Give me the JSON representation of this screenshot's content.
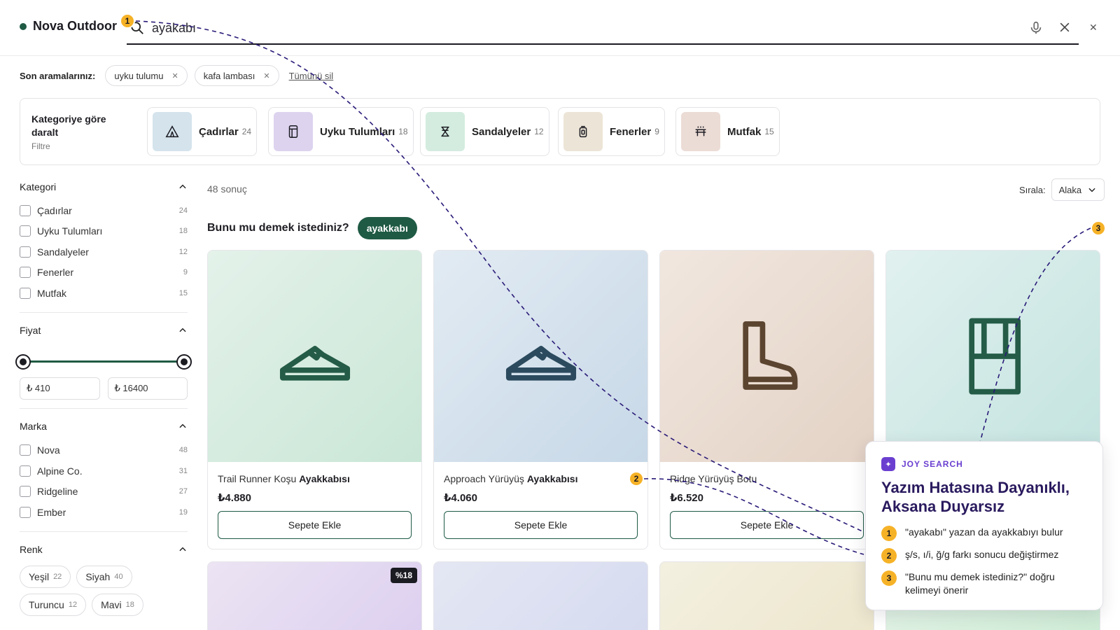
{
  "brand": {
    "name": "Nova Outdoor",
    "dot_color": "#1f5a44"
  },
  "search": {
    "value": "ayakabı",
    "icon": "search-icon"
  },
  "recent": {
    "label": "Son aramalarınız:",
    "items": [
      {
        "label": "uyku tulumu"
      },
      {
        "label": "kafa lambası"
      }
    ],
    "clear_all": "Tümünü sil"
  },
  "category_strip": {
    "title": "Kategoriye göre daralt",
    "subtitle": "Filtre",
    "items": [
      {
        "name": "Çadırlar",
        "count": "24",
        "icon": "tent-icon",
        "color": "#d4e3ec"
      },
      {
        "name": "Uyku Tulumları",
        "count": "18",
        "icon": "sleeping-bag-icon",
        "color": "#ddd3ef"
      },
      {
        "name": "Sandalyeler",
        "count": "12",
        "icon": "chair-icon",
        "color": "#d3ecdf"
      },
      {
        "name": "Fenerler",
        "count": "9",
        "icon": "lantern-icon",
        "color": "#ece4d6"
      },
      {
        "name": "Mutfak",
        "count": "15",
        "icon": "stove-icon",
        "color": "#ecdcd6"
      }
    ]
  },
  "sidebar": {
    "category": {
      "title": "Kategori",
      "items": [
        {
          "label": "Çadırlar",
          "count": "24"
        },
        {
          "label": "Uyku Tulumları",
          "count": "18"
        },
        {
          "label": "Sandalyeler",
          "count": "12"
        },
        {
          "label": "Fenerler",
          "count": "9"
        },
        {
          "label": "Mutfak",
          "count": "15"
        }
      ]
    },
    "price": {
      "title": "Fiyat",
      "min": "₺ 410",
      "max": "₺ 16400"
    },
    "brand": {
      "title": "Marka",
      "items": [
        {
          "label": "Nova",
          "count": "48"
        },
        {
          "label": "Alpine Co.",
          "count": "31"
        },
        {
          "label": "Ridgeline",
          "count": "27"
        },
        {
          "label": "Ember",
          "count": "19"
        }
      ]
    },
    "color": {
      "title": "Renk",
      "items": [
        {
          "label": "Yeşil",
          "count": "22"
        },
        {
          "label": "Siyah",
          "count": "40"
        },
        {
          "label": "Turuncu",
          "count": "12"
        },
        {
          "label": "Mavi",
          "count": "18"
        }
      ]
    }
  },
  "results": {
    "count": "48 sonuç",
    "sort_label": "Sırala:",
    "sort_value": "Alaka",
    "did_you_mean_label": "Bunu mu demek istediniz?",
    "did_you_mean_value": "ayakkabı"
  },
  "products": [
    {
      "title_prefix": "Trail Runner Koşu",
      "title_bold": "Ayakkabısı",
      "price": "₺4.880",
      "button": "Sepete Ekle",
      "icon": "shoe-icon",
      "bg": "#d9ede3"
    },
    {
      "title_prefix": "Approach Yürüyüş",
      "title_bold": "Ayakkabısı",
      "price": "₺4.060",
      "button": "Sepete Ekle",
      "icon": "shoe-icon",
      "bg": "#d7e4ee"
    },
    {
      "title_prefix": "Ridge Yürüyüş Botu",
      "title_bold": "",
      "price": "₺6.520",
      "button": "Sepete Ekle",
      "icon": "boot-icon",
      "bg": "#ecdfd6"
    },
    {
      "title_prefix": "",
      "title_bold": "",
      "price": "",
      "button": "",
      "icon": "gaiter-icon",
      "bg": "#d6ece9"
    }
  ],
  "second_row": {
    "discount": "%18"
  },
  "joy": {
    "label": "JOY SEARCH",
    "title": "Yazım Hatasına Dayanıklı, Aksana Duyarsız",
    "points": [
      {
        "num": "1",
        "text": "\"ayakabı\" yazan da ayakkabıyı bulur"
      },
      {
        "num": "2",
        "text": "ş/s, ı/i, ğ/g farkı sonucu değiştirmez"
      },
      {
        "num": "3",
        "text": "\"Bunu mu demek istediniz?\" doğru kelimeyi önerir"
      }
    ]
  },
  "markers": [
    "1",
    "2",
    "3"
  ],
  "colors": {
    "accent": "#1f5a44",
    "marker": "#f6b227",
    "joy": "#6a3fd0"
  }
}
